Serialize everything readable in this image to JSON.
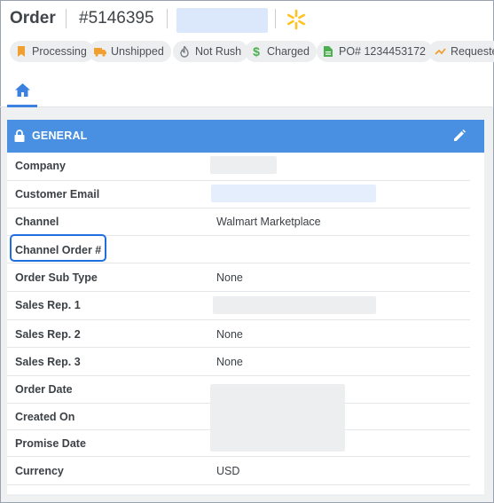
{
  "header": {
    "title": "Order",
    "order_number": "#5146395",
    "channel_icon": "walmart-spark-icon",
    "accent_color": "#ffc220"
  },
  "pills": [
    {
      "label": "Processing",
      "icon": "bookmark-icon",
      "color": "#f0a030"
    },
    {
      "label": "Unshipped",
      "icon": "truck-icon",
      "color": "#f0a030"
    },
    {
      "label": "Not Rush",
      "icon": "fire-icon",
      "color": "#7a7f85"
    },
    {
      "label": "Charged",
      "icon": "dollar-icon",
      "color": "#4caf50"
    },
    {
      "label": "PO# 1234453172",
      "icon": "document-icon",
      "color": "#4caf50"
    },
    {
      "label": "Requeste",
      "icon": "chart-icon",
      "color": "#f0a030"
    }
  ],
  "tabs": {
    "home_icon": "home-icon"
  },
  "card": {
    "title": "GENERAL",
    "header_color": "#4a90e2",
    "rows": [
      {
        "label": "Company",
        "value": ""
      },
      {
        "label": "Customer Email",
        "value": ""
      },
      {
        "label": "Channel",
        "value": "Walmart Marketplace"
      },
      {
        "label": "Channel Order #",
        "value": ""
      },
      {
        "label": "Order Sub Type",
        "value": "None"
      },
      {
        "label": "Sales Rep. 1",
        "value": ""
      },
      {
        "label": "Sales Rep. 2",
        "value": "None"
      },
      {
        "label": "Sales Rep. 3",
        "value": "None"
      },
      {
        "label": "Order Date",
        "value": ""
      },
      {
        "label": "Created On",
        "value": ""
      },
      {
        "label": "Promise Date",
        "value": ""
      },
      {
        "label": "Currency",
        "value": "USD"
      }
    ]
  }
}
